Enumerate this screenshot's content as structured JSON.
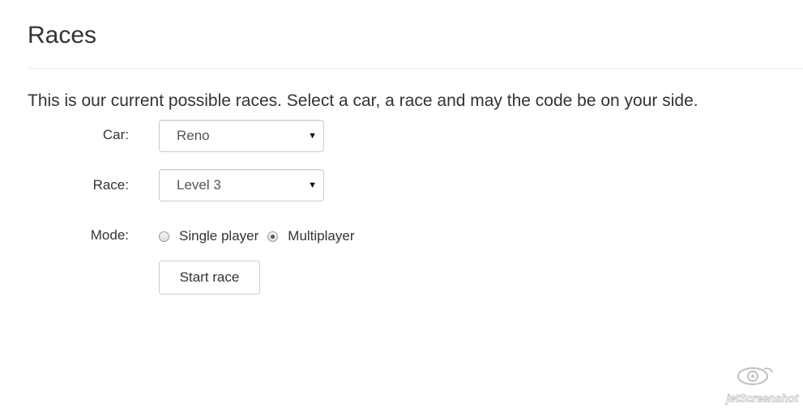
{
  "page": {
    "title": "Races",
    "intro": "This is our current possible races. Select a car, a race and may the code be on your side."
  },
  "form": {
    "car": {
      "label": "Car:",
      "selected": "Reno"
    },
    "race": {
      "label": "Race:",
      "selected": "Level 3"
    },
    "mode": {
      "label": "Mode:",
      "options": [
        {
          "label": "Single player",
          "checked": false
        },
        {
          "label": "Multiplayer",
          "checked": true
        }
      ]
    },
    "submit_label": "Start race"
  },
  "watermark": {
    "text": "jetScreenshot",
    "icon": "eye-swirl-logo-icon"
  }
}
